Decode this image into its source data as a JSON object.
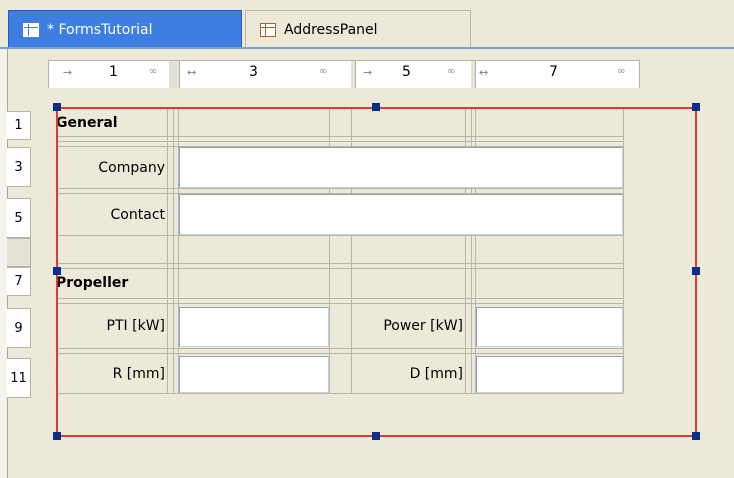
{
  "tabs": [
    {
      "label": "* FormsTutorial",
      "icon": "form-icon",
      "active": true
    },
    {
      "label": "AddressPanel",
      "icon": "panel-icon",
      "active": false
    }
  ],
  "columns": [
    "1",
    "3",
    "5",
    "7"
  ],
  "rows": [
    "1",
    "3",
    "5",
    "7",
    "9",
    "11"
  ],
  "form": {
    "section_general": "General",
    "company_label": "Company",
    "contact_label": "Contact",
    "section_propeller": "Propeller",
    "pti_label": "PTI [kW]",
    "power_label": "Power [kW]",
    "r_label": "R [mm]",
    "d_label": "D [mm]"
  },
  "colors": {
    "selection": "#e23a2c",
    "active_tab": "#3c7fe1"
  }
}
